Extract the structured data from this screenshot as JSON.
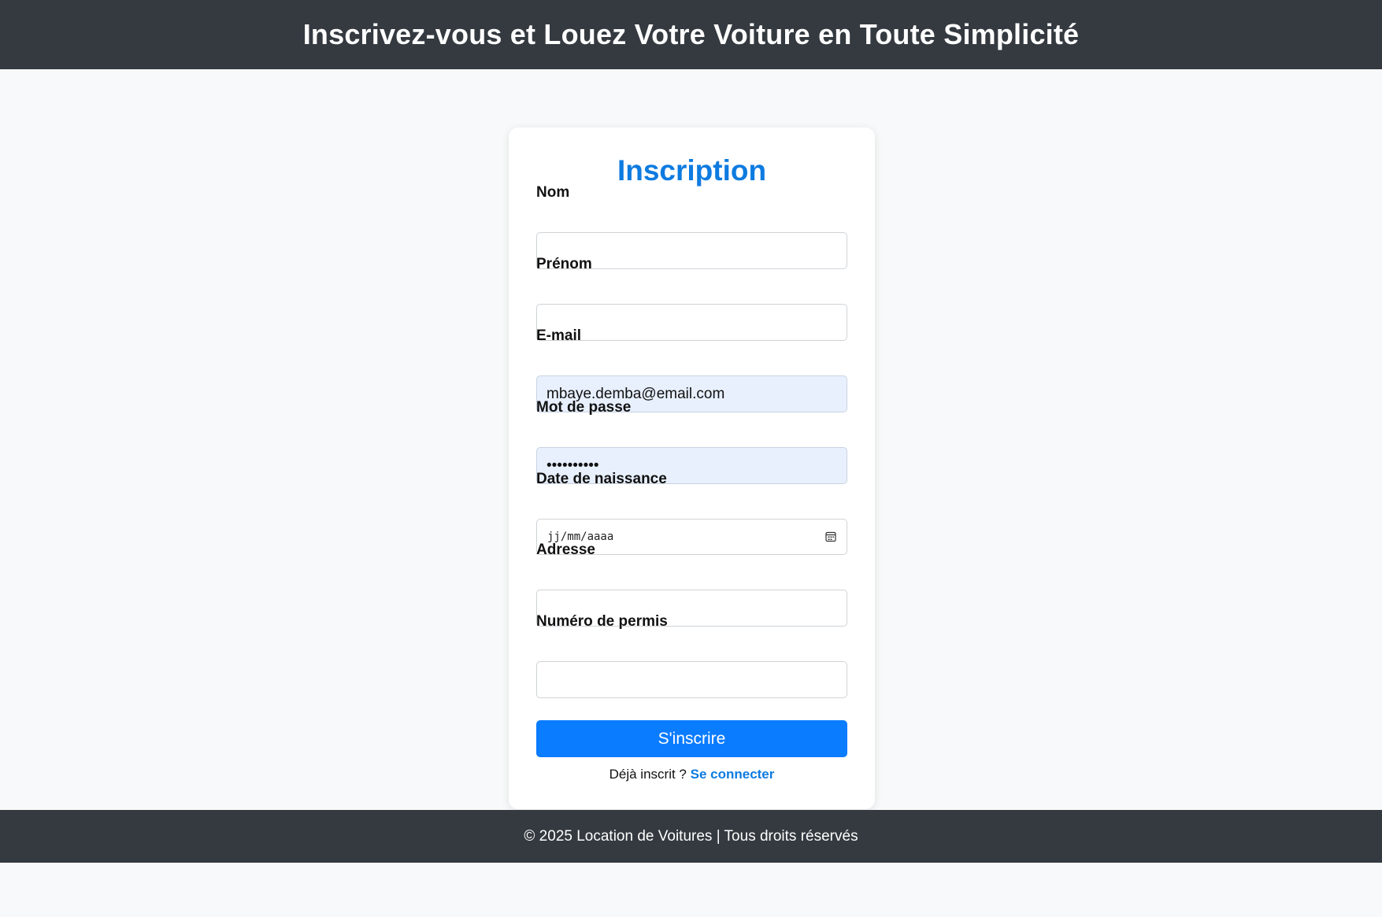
{
  "header": {
    "title": "Inscrivez-vous et Louez Votre Voiture en Toute Simplicité"
  },
  "form": {
    "title": "Inscription",
    "fields": {
      "nom": {
        "label": "Nom",
        "value": ""
      },
      "prenom": {
        "label": "Prénom",
        "value": ""
      },
      "email": {
        "label": "E-mail",
        "value": "mbaye.demba@email.com"
      },
      "password": {
        "label": "Mot de passe",
        "value": "••••••••••"
      },
      "birthdate": {
        "label": "Date de naissance",
        "placeholder": "jj/mm/aaaa"
      },
      "adresse": {
        "label": "Adresse",
        "value": ""
      },
      "permis": {
        "label": "Numéro de permis",
        "value": ""
      }
    },
    "submit_label": "S'inscrire",
    "login_prompt": "Déjà inscrit ?",
    "login_link": "Se connecter"
  },
  "footer": {
    "text": "© 2025 Location de Voitures | Tous droits réservés"
  },
  "colors": {
    "header_bg": "#343a40",
    "accent": "#0a7cff",
    "title_blue": "#0d7be0",
    "autofill_bg": "#e8f0fe",
    "page_bg": "#f8f9fa"
  },
  "icons": {
    "date_picker": "calendar-icon"
  }
}
